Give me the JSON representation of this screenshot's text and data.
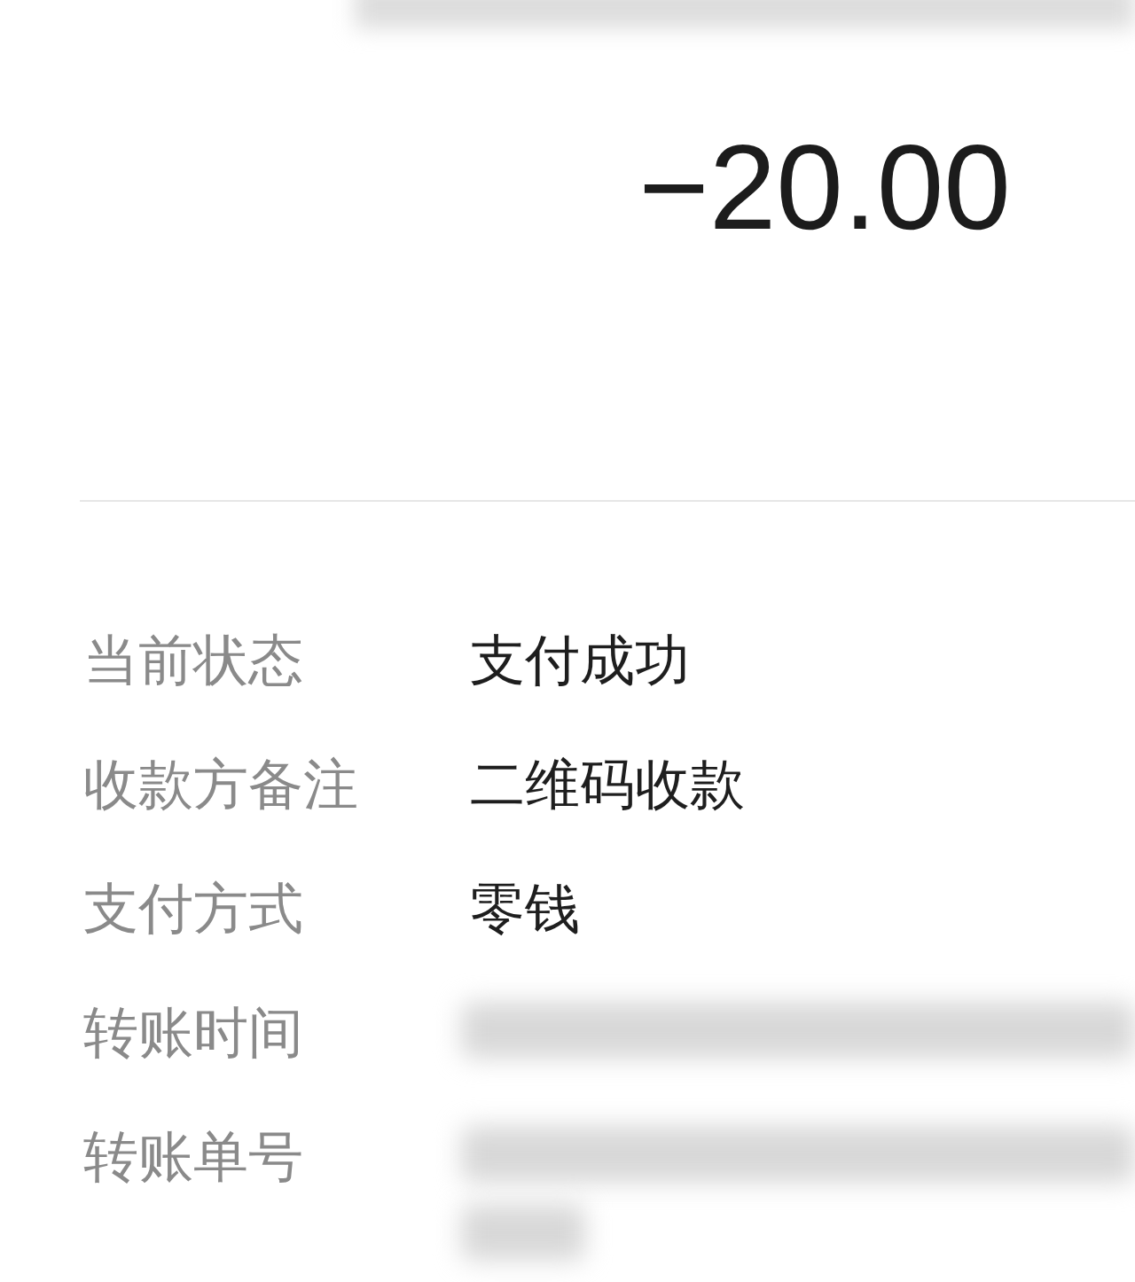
{
  "amount": "−20.00",
  "details": [
    {
      "label": "当前状态",
      "value": "支付成功",
      "kind": "text"
    },
    {
      "label": "收款方备注",
      "value": "二维码收款",
      "kind": "text"
    },
    {
      "label": "支付方式",
      "value": "零钱",
      "kind": "text"
    },
    {
      "label": "转账时间",
      "kind": "redacted"
    },
    {
      "label": "转账单号",
      "kind": "redacted"
    }
  ]
}
